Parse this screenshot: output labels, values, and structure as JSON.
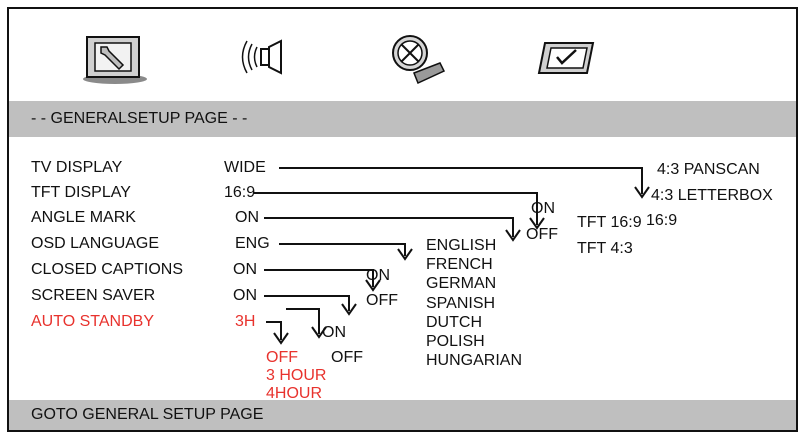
{
  "tabs": [
    {
      "icon": "general-setup-icon"
    },
    {
      "icon": "audio-speaker-icon"
    },
    {
      "icon": "video-film-icon"
    },
    {
      "icon": "preference-checklist-icon"
    }
  ],
  "header": {
    "title": "- -  GENERALSETUP PAGE  - -"
  },
  "menu": {
    "items": [
      {
        "label": "TV DISPLAY",
        "value": "WIDE"
      },
      {
        "label": "TFT DISPLAY",
        "value": "16:9"
      },
      {
        "label": "ANGLE MARK",
        "value": "ON"
      },
      {
        "label": "OSD LANGUAGE",
        "value": "ENG"
      },
      {
        "label": "CLOSED CAPTIONS",
        "value": "ON"
      },
      {
        "label": "SCREEN SAVER",
        "value": "ON"
      },
      {
        "label": "AUTO STANDBY",
        "value": "3H"
      }
    ]
  },
  "options": {
    "tv_display": [
      "4:3 PANSCAN",
      "4:3 LETTERBOX",
      "16:9"
    ],
    "tft_display": [
      "TFT 16:9",
      "TFT 4:3"
    ],
    "angle_mark": [
      "ON",
      "OFF"
    ],
    "osd_language": [
      "ENGLISH",
      "FRENCH",
      "GERMAN",
      "SPANISH",
      "DUTCH",
      "POLISH",
      "HUNGARIAN"
    ],
    "closed_captions": [
      "ON",
      "OFF"
    ],
    "screen_saver": [
      "ON",
      "OFF"
    ],
    "auto_standby": [
      "OFF",
      "3 HOUR",
      "4HOUR"
    ]
  },
  "footer": {
    "status": "GOTO GENERAL SETUP PAGE"
  },
  "colors": {
    "highlight": "#e8322d",
    "bar": "#bfbfbf",
    "text": "#111111"
  }
}
